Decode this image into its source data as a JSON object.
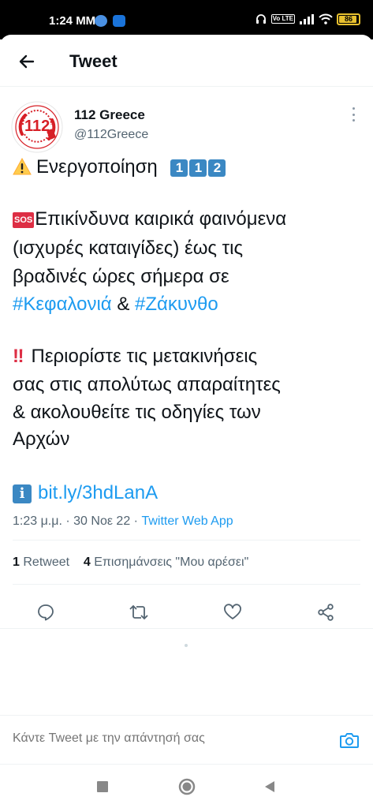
{
  "status_bar": {
    "time": "1:24 MM",
    "volte": "Vo LTE",
    "battery": "86"
  },
  "header": {
    "title": "Tweet"
  },
  "tweet": {
    "author_name": "112 Greece",
    "author_handle": "@112Greece",
    "lines": {
      "l1": "Ενεργοποίηση",
      "l1_digits": [
        "1",
        "1",
        "2"
      ],
      "sos": "SOS",
      "l2": "Επικίνδυνα καιρικά φαινόμενα",
      "l3": "(ισχυρές καταιγίδες) έως τις",
      "l4": "βραδινές ώρες σήμερα σε",
      "l5_hashtag1": "#Κεφαλονιά",
      "l5_amp": " & ",
      "l5_hashtag2": "#Ζάκυνθο",
      "bang": "‼",
      "l6": "Περιορίστε τις μετακινήσεις",
      "l7": "σας στις απολύτως απαραίτητες",
      "l8": "& ακολουθείτε τις οδηγίες των",
      "l9": "Αρχών",
      "info": "i",
      "link": "bit.ly/3hdLanA"
    },
    "meta": {
      "time": "1:23 μ.μ.",
      "sep1": " · ",
      "date": "30 Νοε 22",
      "sep2": " · ",
      "source": "Twitter Web App"
    },
    "stats": {
      "retweets_count": "1",
      "retweets_label": "Retweet",
      "likes_count": "4",
      "likes_label": "Επισημάνσεις \"Μου αρέσει\""
    }
  },
  "actions": {
    "icons": [
      "reply-icon",
      "retweet-icon",
      "like-icon",
      "share-icon"
    ]
  },
  "reply": {
    "placeholder": "Κάντε Tweet με την απάντησή σας"
  },
  "colors": {
    "accent": "#1d9bf0",
    "secondary_text": "#536471",
    "primary_text": "#0f1419",
    "keycap": "#3b88c3",
    "sos_red": "#dd2e44"
  }
}
